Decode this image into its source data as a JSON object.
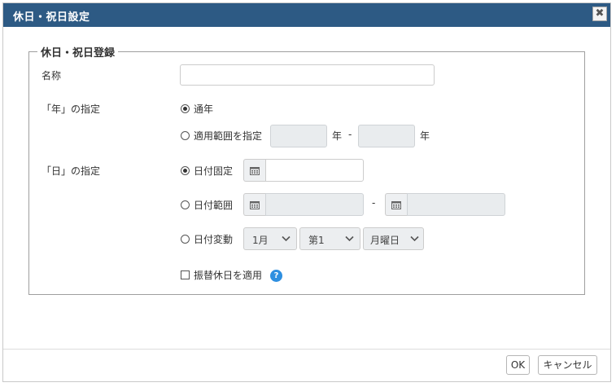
{
  "dialog": {
    "title": "休日・祝日設定",
    "close_glyph": "✖"
  },
  "group": {
    "legend": "休日・祝日登録"
  },
  "name_row": {
    "label": "名称",
    "value": ""
  },
  "year_row": {
    "label": "「年」の指定",
    "option_all": "通年",
    "option_range": "適用範囲を指定",
    "from_value": "",
    "year_unit_1": "年",
    "dash": "-",
    "to_value": "",
    "year_unit_2": "年",
    "selected": "通年"
  },
  "day_row": {
    "label": "「日」の指定",
    "option_fixed": "日付固定",
    "option_range": "日付範囲",
    "option_variable": "日付変動",
    "dash": "-",
    "selected": "日付固定",
    "fixed_value": "",
    "range_from": "",
    "range_to": "",
    "variable_month": "1月",
    "variable_week": "第1",
    "variable_weekday": "月曜日"
  },
  "substitute": {
    "label": "振替休日を適用",
    "checked": false,
    "help_glyph": "?"
  },
  "footer": {
    "ok_label": "OK",
    "cancel_label": "キャンセル"
  },
  "colors": {
    "titlebar": "#2d5a84",
    "help_icon": "#2e8fe0",
    "disabled_input": "#e9ecee"
  }
}
